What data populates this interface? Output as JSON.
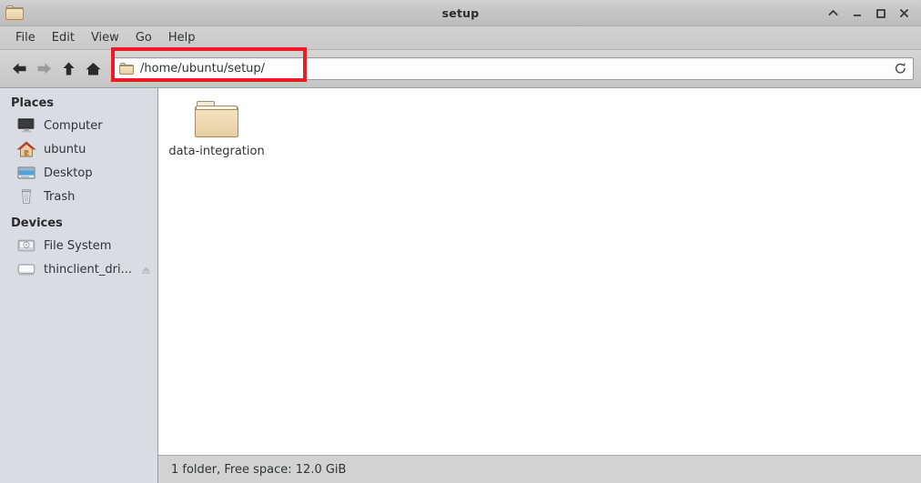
{
  "window": {
    "title": "setup",
    "icon": "folder-icon",
    "controls": [
      {
        "name": "shade-button",
        "glyph": "chevron-up"
      },
      {
        "name": "minimize-button",
        "glyph": "minimize"
      },
      {
        "name": "maximize-button",
        "glyph": "maximize"
      },
      {
        "name": "close-button",
        "glyph": "close"
      }
    ]
  },
  "menubar": {
    "items": [
      {
        "label": "File"
      },
      {
        "label": "Edit"
      },
      {
        "label": "View"
      },
      {
        "label": "Go"
      },
      {
        "label": "Help"
      }
    ]
  },
  "toolbar": {
    "back": {
      "name": "back-button",
      "enabled": true
    },
    "forward": {
      "name": "forward-button",
      "enabled": false
    },
    "up": {
      "name": "up-button",
      "enabled": true
    },
    "home": {
      "name": "home-button",
      "enabled": true
    },
    "path": {
      "value": "/home/ubuntu/setup/",
      "placeholder": "Location",
      "icon": "folder-icon"
    },
    "reload": {
      "name": "reload-button",
      "glyph": "reload"
    },
    "highlight_color": "#ed1c24"
  },
  "sidebar": {
    "sections": [
      {
        "header": "Places",
        "items": [
          {
            "label": "Computer",
            "icon": "computer-icon"
          },
          {
            "label": "ubuntu",
            "icon": "home-folder-icon"
          },
          {
            "label": "Desktop",
            "icon": "desktop-icon"
          },
          {
            "label": "Trash",
            "icon": "trash-icon"
          }
        ]
      },
      {
        "header": "Devices",
        "items": [
          {
            "label": "File System",
            "icon": "harddisk-icon"
          },
          {
            "label": "thinclient_dri...",
            "icon": "drive-icon",
            "eject": true
          }
        ]
      }
    ]
  },
  "main": {
    "files": [
      {
        "name": "data-integration",
        "type": "folder"
      }
    ]
  },
  "statusbar": {
    "text": "1 folder, Free space: 12.0 GiB"
  },
  "colors": {
    "sidebar_bg": "#d9dce3",
    "content_bg": "#ffffff",
    "chrome_bg": "#d2d2d2",
    "highlight": "#ed1c24",
    "folder": "#e8cfa3"
  }
}
